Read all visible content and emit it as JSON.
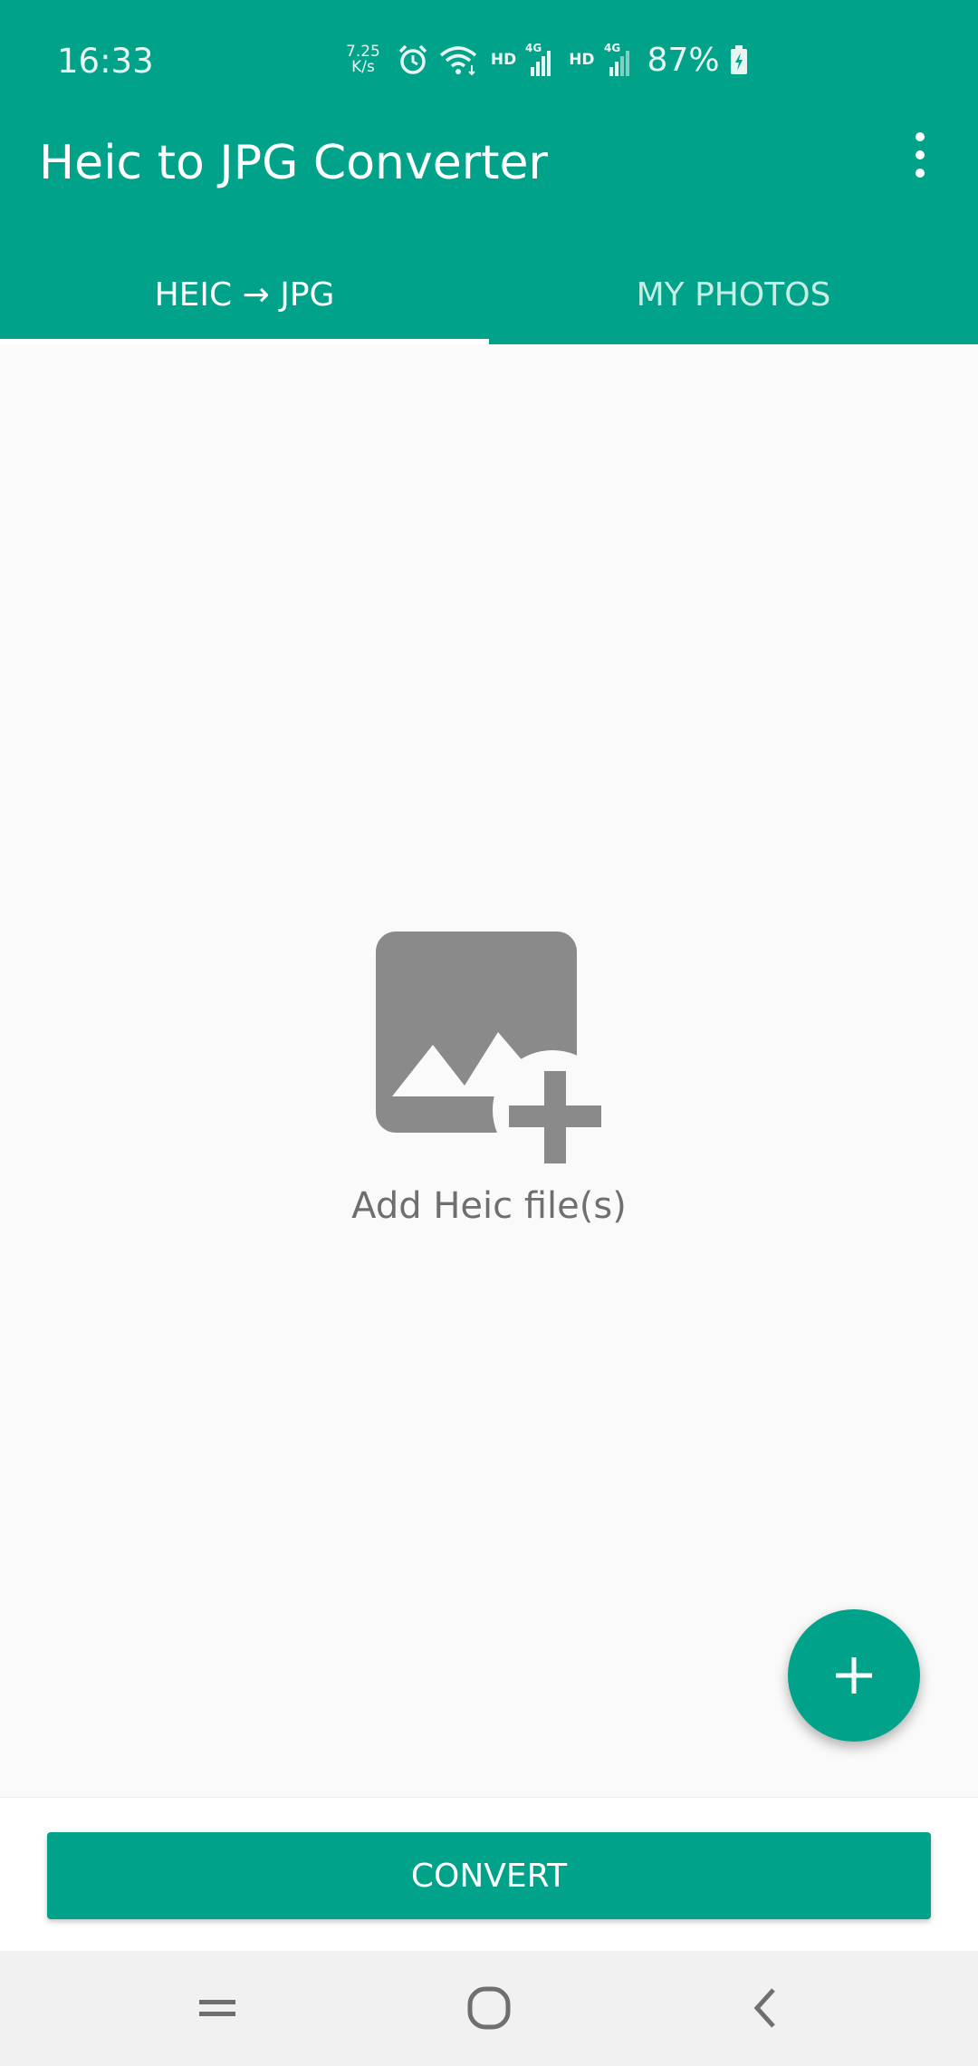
{
  "status_bar": {
    "time": "16:33",
    "net_speed_value": "7.25",
    "net_speed_unit": "K/s",
    "hd_label_1": "HD",
    "network_label_1": "4G",
    "hd_label_2": "HD",
    "network_label_2": "4G",
    "battery": "87%"
  },
  "app_bar": {
    "title": "Heic to JPG Converter"
  },
  "tabs": [
    {
      "label": "HEIC → JPG",
      "selected": true
    },
    {
      "label": "MY PHOTOS",
      "selected": false
    }
  ],
  "empty_state": {
    "label": "Add Heic file(s)",
    "icon": "add-photo-icon"
  },
  "fab": {
    "icon": "plus-icon"
  },
  "convert_button": {
    "label": "CONVERT"
  },
  "nav_bar": {
    "buttons": [
      "recents-icon",
      "home-icon",
      "back-icon"
    ]
  },
  "colors": {
    "primary": "#00a28a",
    "background": "#fafafa",
    "icon_gray": "#8a8a8a",
    "text_gray": "#6f6f6f",
    "nav_bar": "#f1f1f1"
  }
}
